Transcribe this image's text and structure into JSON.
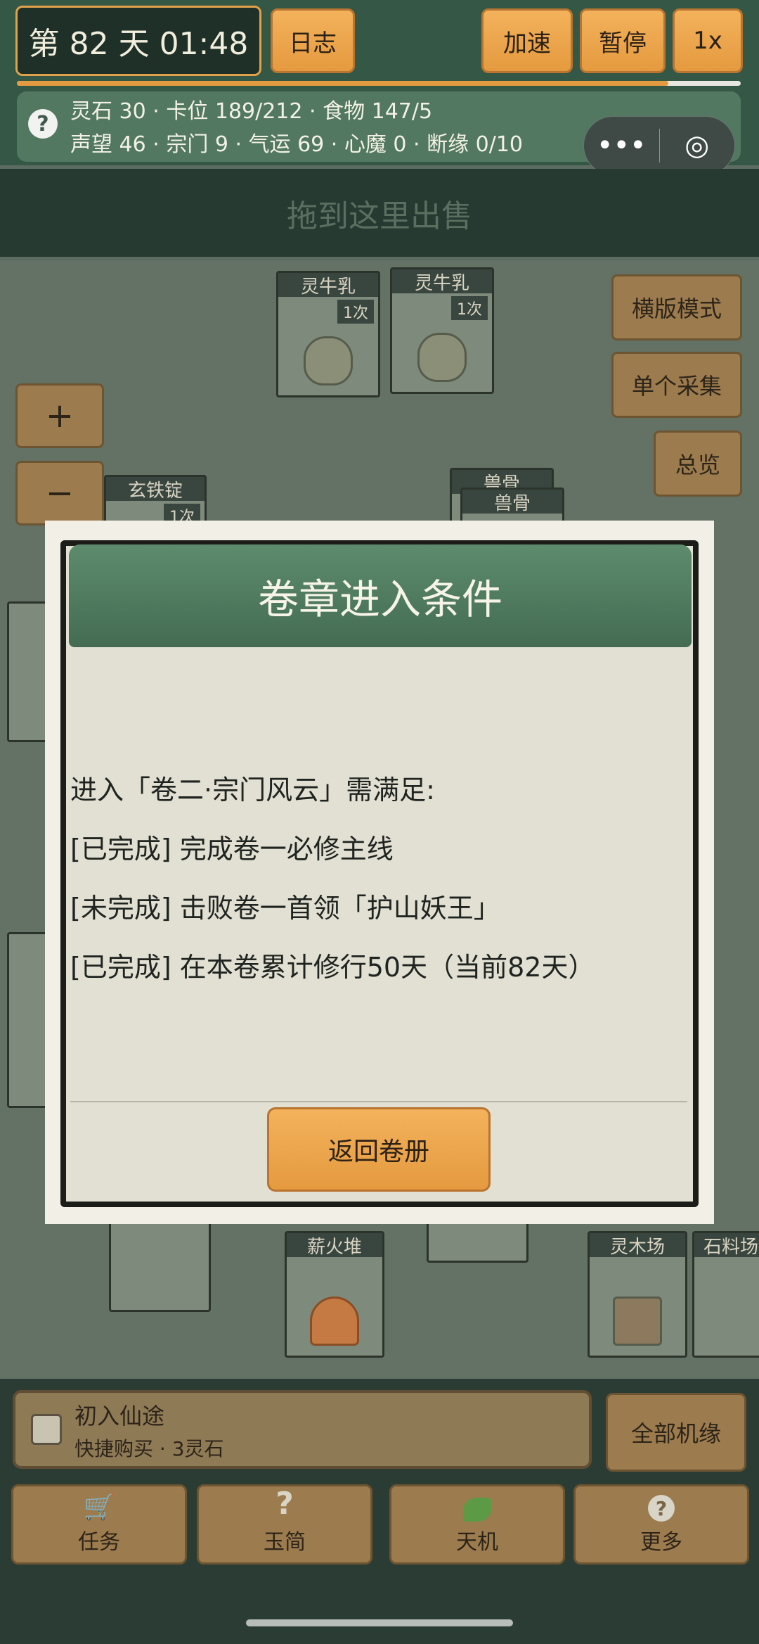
{
  "top": {
    "day_display": "第 82 天 01:48",
    "log_label": "日志",
    "speedup_label": "加速",
    "pause_label": "暂停",
    "speed_label": "1x",
    "day_progress": 0.9
  },
  "stats": {
    "line1": "灵石 30  ·  卡位 189/212  ·  食物 147/5",
    "line2": "声望 46 · 宗门 9 · 气运 69 · 心魔 0 · 断缘 0/10",
    "help_icon": "?"
  },
  "capsule": {
    "more_icon": "•••",
    "close_icon": "◎"
  },
  "sell_zone": "拖到这里出售",
  "cards": [
    {
      "label": "灵牛乳",
      "badge": "1次"
    },
    {
      "label": "灵牛乳",
      "badge": "1次"
    },
    {
      "label": "玄铁锭",
      "badge": "1次"
    },
    {
      "label": "兽骨",
      "badge": ""
    },
    {
      "label": "兽骨",
      "badge": ""
    },
    {
      "label": "薪火堆",
      "badge": ""
    },
    {
      "label": "灵木场",
      "badge": ""
    },
    {
      "label": "石料场",
      "badge": ""
    }
  ],
  "side_buttons": {
    "landscape": "横版模式",
    "single_collect": "单个采集",
    "overview": "总览"
  },
  "zoom": {
    "plus": "+",
    "minus": "−"
  },
  "modal": {
    "title": "卷章进入条件",
    "intro": "进入「卷二·宗门风云」需满足:",
    "items": [
      "[已完成] 完成卷一必修主线",
      "[未完成] 击败卷一首领「护山妖王」",
      "[已完成] 在本卷累计修行50天（当前82天）"
    ],
    "button": "返回卷册"
  },
  "bottom": {
    "chapter_title": "初入仙途",
    "chapter_sub": "快捷购买  ·  3灵石",
    "all_label": "全部机缘",
    "tabs": [
      {
        "label": "任务",
        "icon": "cart-icon"
      },
      {
        "label": "玉简",
        "icon": "question-icon"
      },
      {
        "label": "天机",
        "icon": "leaf-icon"
      },
      {
        "label": "更多",
        "icon": "help-icon"
      }
    ]
  }
}
